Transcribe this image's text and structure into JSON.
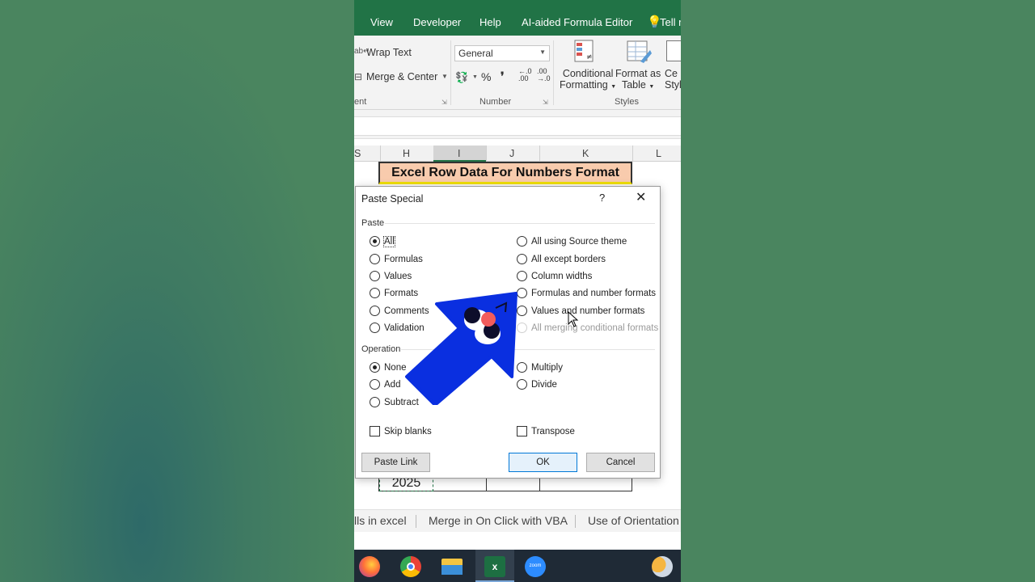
{
  "ribbon_tabs": [
    "View",
    "Developer",
    "Help",
    "AI-aided Formula Editor",
    "Tell m"
  ],
  "ribbon": {
    "wrap_text": "Wrap Text",
    "merge_center": "Merge & Center",
    "alignment_group": "ent",
    "number_format": "General",
    "number_group": "Number",
    "conditional_formatting": [
      "Conditional",
      "Formatting"
    ],
    "format_as_table": [
      "Format as",
      "Table"
    ],
    "cell_styles": [
      "Ce",
      "Style"
    ],
    "styles_group": "Styles",
    "percent_symbol": "%",
    "comma_symbol": "❜",
    "increase_decimal": ".00",
    "decrease_decimal": ".0"
  },
  "columns": [
    "S",
    "H",
    "I",
    "J",
    "K",
    "L"
  ],
  "sheet": {
    "title_cell": "Excel Row Data For Numbers Format",
    "bottom_value": "2025"
  },
  "dialog": {
    "title": "Paste Special",
    "help": "?",
    "close": "✕",
    "paste_label": "Paste",
    "paste_left": [
      "All",
      "Formulas",
      "Values",
      "Formats",
      "Comments",
      "Validation"
    ],
    "paste_right": [
      "All using Source theme",
      "All except borders",
      "Column widths",
      "Formulas and number formats",
      "Values and number formats",
      "All merging conditional formats"
    ],
    "paste_selected": "All",
    "operation_label": "Operation",
    "operation_left": [
      "None",
      "Add",
      "Subtract"
    ],
    "operation_right": [
      "Multiply",
      "Divide"
    ],
    "operation_selected": "None",
    "skip_blanks": "Skip blanks",
    "transpose": "Transpose",
    "paste_link": "Paste Link",
    "ok": "OK",
    "cancel": "Cancel"
  },
  "sheet_tabs": [
    "lls in excel",
    "Merge in On Click with VBA",
    "Use of Orientation C"
  ],
  "taskbar_icons": [
    "firefox-icon",
    "chrome-icon",
    "file-explorer-icon",
    "excel-icon",
    "zoom-icon",
    "weather-icon"
  ],
  "taskbar_zoom_label": "zoom",
  "taskbar_excel_label": "x",
  "colors": {
    "excel_green": "#217346",
    "title_fill": "#f8cbad",
    "arrow_blue": "#0a2fe0",
    "taskbar": "#1f2a36"
  }
}
